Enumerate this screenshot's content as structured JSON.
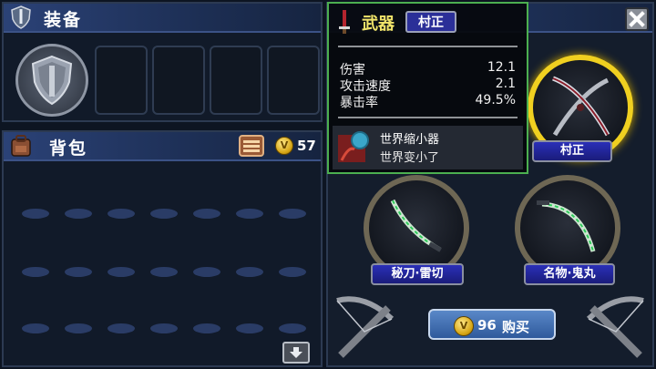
{
  "equip_panel": {
    "title": "装备"
  },
  "bag_panel": {
    "title": "背包",
    "coin_count": "57"
  },
  "weapons": [
    {
      "label": "村正",
      "selected": true
    },
    {
      "label": "秘刀·雷切",
      "selected": false
    },
    {
      "label": "名物·鬼丸",
      "selected": false
    }
  ],
  "buy_button": {
    "price": "96",
    "label": "购买"
  },
  "tooltip": {
    "category": "武器",
    "name": "村正",
    "stats": [
      {
        "label": "伤害",
        "value": "12.1"
      },
      {
        "label": "攻击速度",
        "value": "2.1"
      },
      {
        "label": "暴击率",
        "value": "49.5%"
      }
    ],
    "skill_name": "世界缩小器",
    "skill_desc": "世界变小了"
  },
  "colors": {
    "accent_gold": "#f0d020",
    "tooltip_border": "#4caf50",
    "label_blue": "#2a2fb8"
  }
}
